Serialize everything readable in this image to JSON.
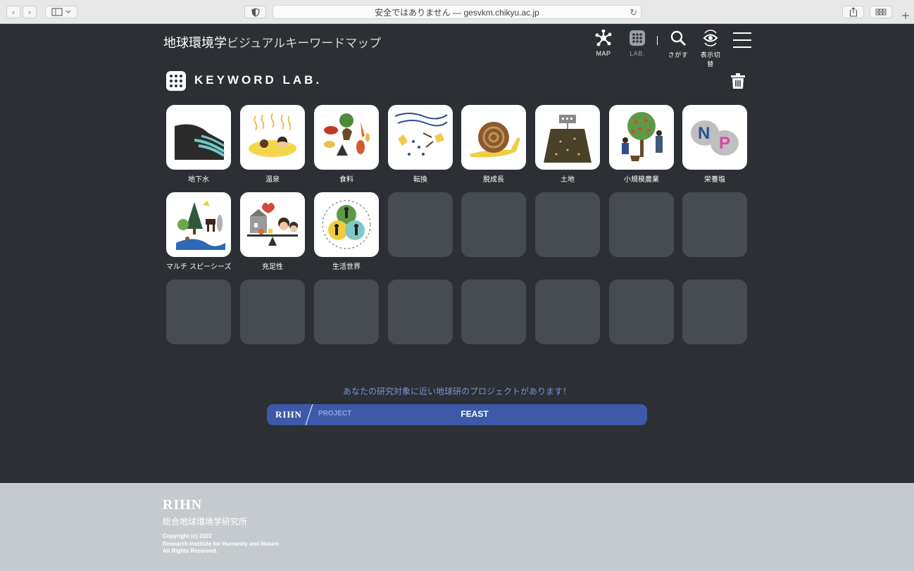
{
  "browser": {
    "address": "安全ではありません — gesvkm.chikyu.ac.jp",
    "back_glyph": "‹",
    "forward_glyph": "›"
  },
  "header": {
    "title_main": "地球環境学",
    "title_sub": "ビジュアルキーワードマップ",
    "nav": [
      {
        "label": "MAP",
        "icon": "map-network-icon"
      },
      {
        "label": "LAB.",
        "icon": "grid-dots-icon"
      },
      {
        "label": "さがす",
        "icon": "search-icon"
      },
      {
        "label": "表示切替",
        "icon": "view-toggle-icon"
      }
    ]
  },
  "lab": {
    "title": "KEYWORD LAB."
  },
  "keywords": [
    {
      "label": "地下水",
      "icon": "groundwater-icon"
    },
    {
      "label": "温泉",
      "icon": "hot-spring-icon"
    },
    {
      "label": "食料",
      "icon": "food-icon"
    },
    {
      "label": "転換",
      "icon": "transition-icon"
    },
    {
      "label": "脱成長",
      "icon": "snail-icon"
    },
    {
      "label": "土地",
      "icon": "land-icon"
    },
    {
      "label": "小規模農業",
      "icon": "small-farming-icon"
    },
    {
      "label": "栄養塩",
      "icon": "nutrients-np-icon"
    },
    {
      "label": "マルチ スピーシーズ",
      "icon": "multispecies-icon"
    },
    {
      "label": "充足性",
      "icon": "sufficiency-icon"
    },
    {
      "label": "生活世界",
      "icon": "lifeworld-icon"
    }
  ],
  "project": {
    "notice": "あなたの研究対象に近い地球研のプロジェクトがあります！",
    "logo": "RIHN",
    "label": "PROJECT",
    "name": "FEAST"
  },
  "footer": {
    "logo": "RIHN",
    "institute": "総合地球環境学研究所",
    "copyright_lines": [
      "Copyright (c) 2022",
      "Research Institute for Humanity and Nature",
      "All Rights Reserved."
    ]
  },
  "colors": {
    "background": "#2c2f33",
    "empty_slot": "#474c52",
    "banner": "#3d59a8",
    "notice": "#7b93d6",
    "footer": "#c5cace"
  }
}
